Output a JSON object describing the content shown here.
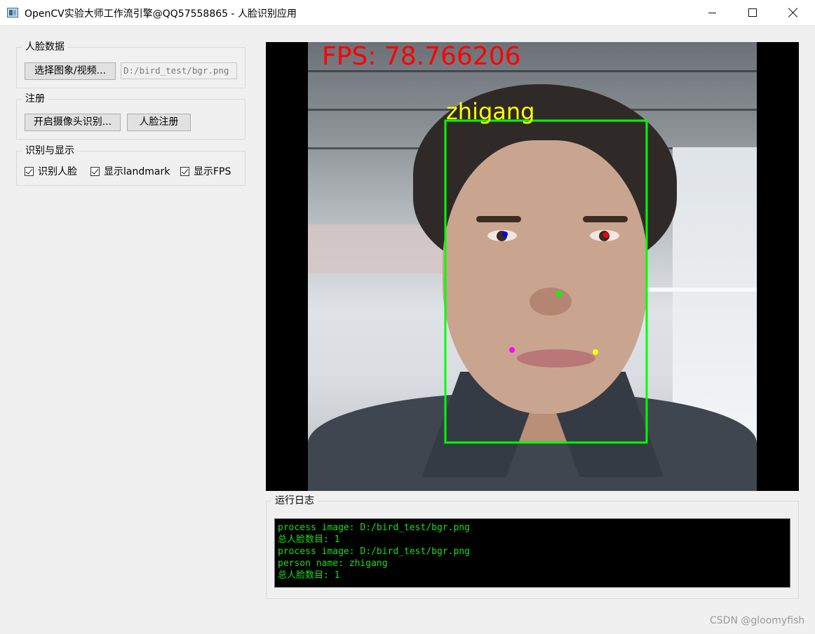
{
  "window": {
    "title": "OpenCV实验大师工作流引擎@QQ57558865 - 人脸识别应用",
    "app_icon": "opencv-window-icon",
    "minimize_icon": "minimize-icon",
    "maximize_icon": "maximize-icon",
    "close_icon": "close-icon"
  },
  "face_data": {
    "group_title": "人脸数据",
    "select_button": "选择图象/视频...",
    "path_value": "D:/bird_test/bgr.png"
  },
  "register": {
    "group_title": "注册",
    "camera_button": "开启摄像头识别...",
    "register_button": "人脸注册"
  },
  "display": {
    "group_title": "识别与显示",
    "checkboxes": [
      {
        "label": "识别人脸",
        "checked": true
      },
      {
        "label": "显示landmark",
        "checked": true
      },
      {
        "label": "显示FPS",
        "checked": true
      }
    ]
  },
  "video": {
    "fps_text": "FPS: 78.766206",
    "person_name": "zhigang",
    "box_color": "#00ff00",
    "fps_color": "#ff0000",
    "name_color": "#ffff00",
    "landmark_colors": [
      "#0000ff",
      "#ff0000",
      "#00ff00",
      "#ff00ff",
      "#ffff00"
    ]
  },
  "log": {
    "group_title": "运行日志",
    "lines": [
      "process image: D:/bird_test/bgr.png",
      "总人脸数目: 1",
      "process image: D:/bird_test/bgr.png",
      "person name: zhigang",
      "总人脸数目: 1"
    ],
    "text_color": "#18e018"
  },
  "watermark": "CSDN @gloomyfish"
}
